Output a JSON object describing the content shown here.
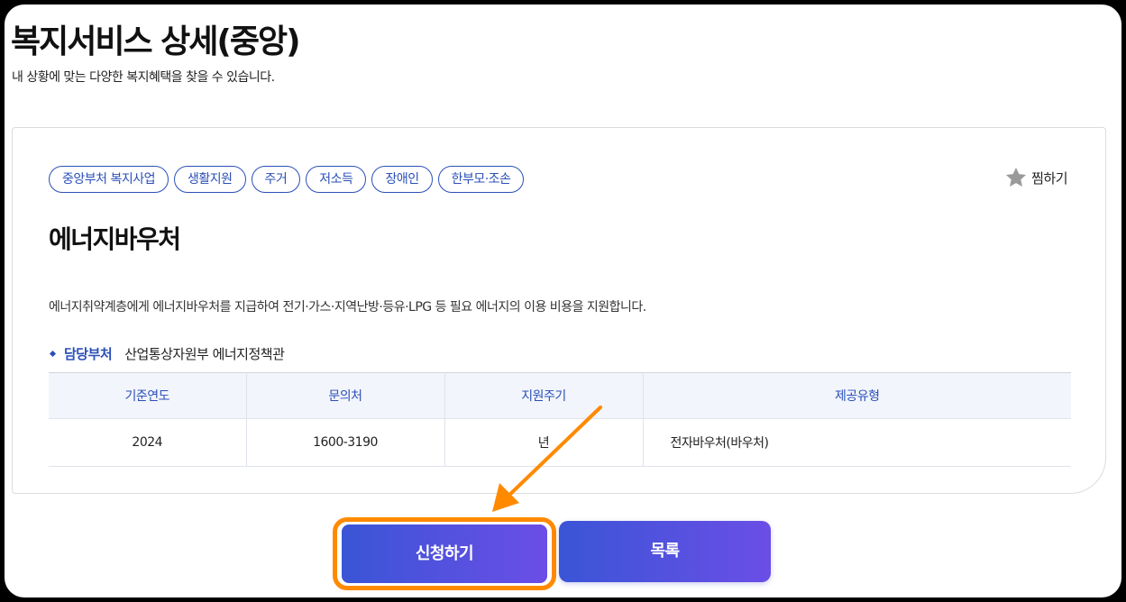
{
  "header": {
    "title": "복지서비스 상세(중앙)",
    "subtitle": "내 상황에 맞는 다양한 복지혜택을 찾을 수 있습니다."
  },
  "service": {
    "tags": [
      "중앙부처 복지사업",
      "생활지원",
      "주거",
      "저소득",
      "장애인",
      "한부모·조손"
    ],
    "favorite_label": "찜하기",
    "name": "에너지바우처",
    "description": "에너지취약계층에게 에너지바우처를 지급하여 전기·가스·지역난방·등유·LPG 등 필요 에너지의 이용 비용을 지원합니다.",
    "department_label": "담당부처",
    "department_value": "산업통상자원부 에너지정책관",
    "table": {
      "headers": [
        "기준연도",
        "문의처",
        "지원주기",
        "제공유형"
      ],
      "row": [
        "2024",
        "1600-3190",
        "년",
        "전자바우처(바우처)"
      ]
    }
  },
  "actions": {
    "apply_label": "신청하기",
    "list_label": "목록"
  },
  "colors": {
    "accent": "#2b4fb8",
    "button_start": "#3a55d6",
    "button_end": "#6b4ee6",
    "highlight": "#ff8a00"
  },
  "icons": {
    "favorite": "star-icon"
  }
}
